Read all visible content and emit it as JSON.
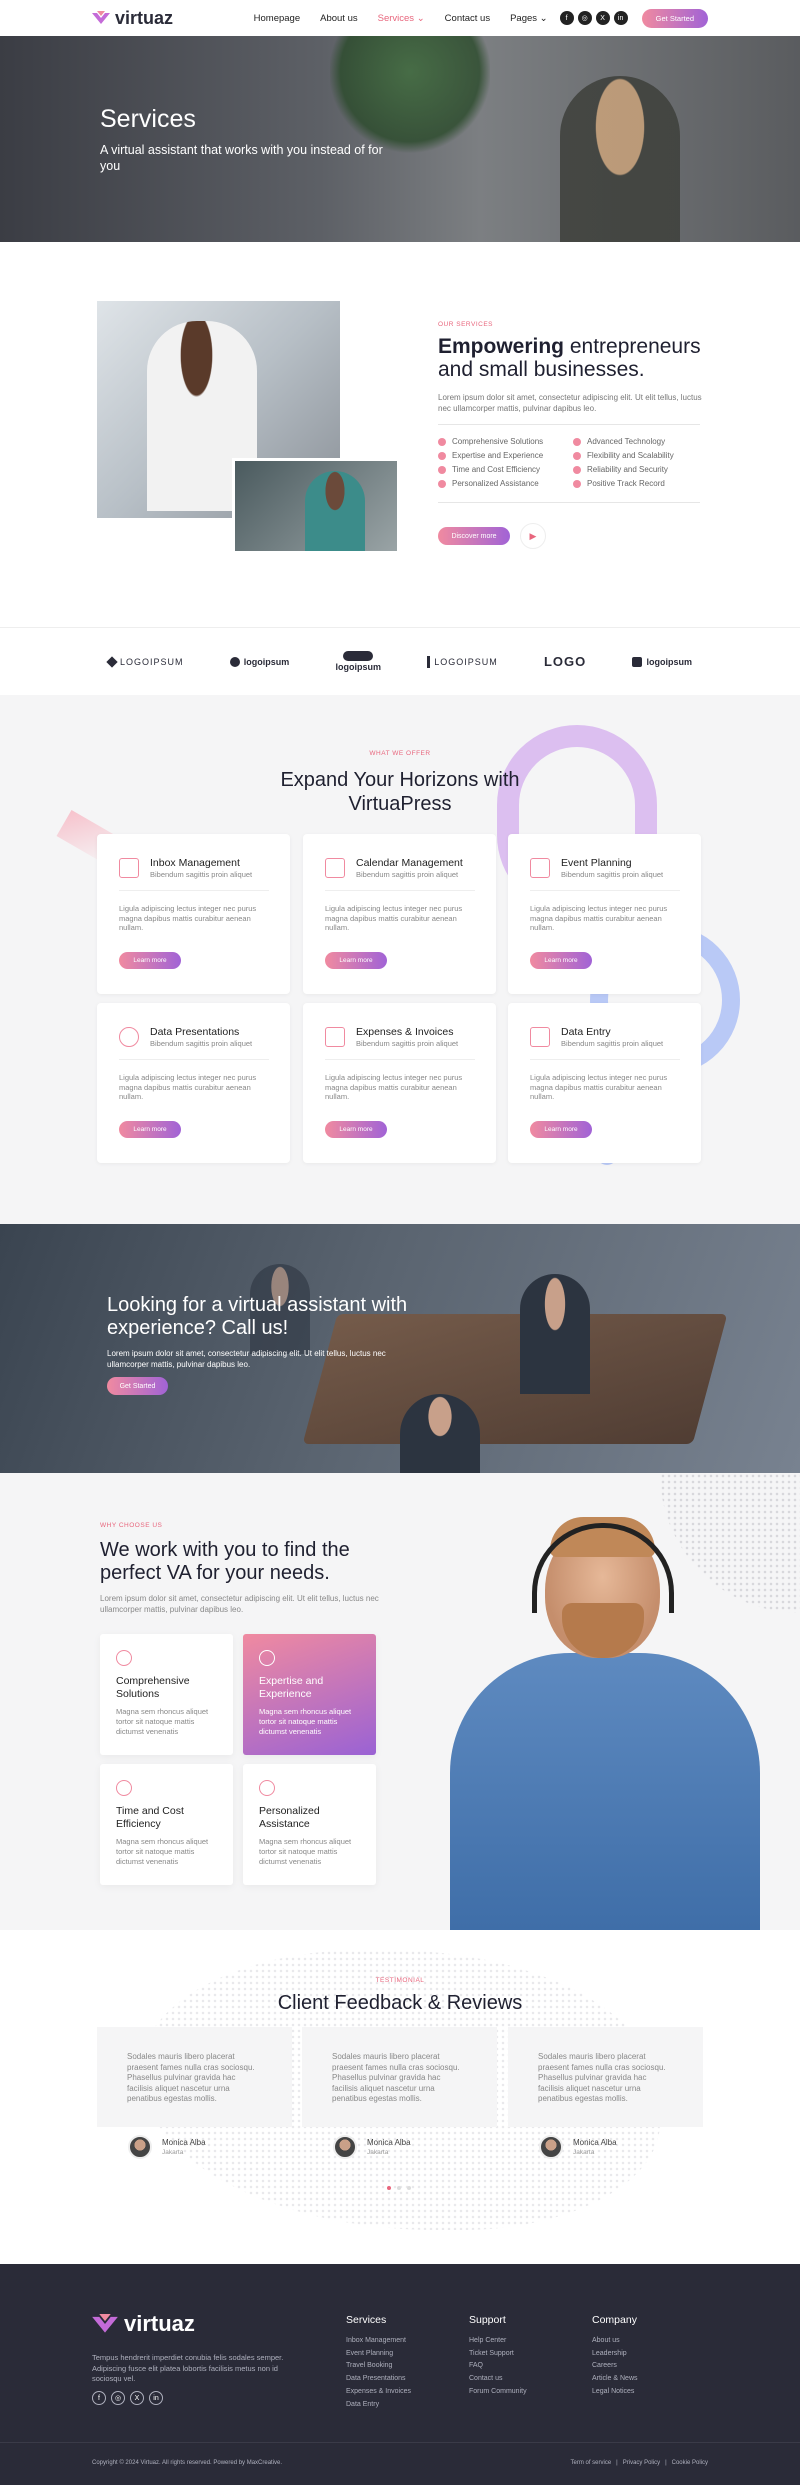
{
  "brand": {
    "name": "virtuaz",
    "accent": "#e8667d",
    "gradient_start": "#f08aa0",
    "gradient_end": "#a163d6"
  },
  "nav": {
    "links": [
      "Homepage",
      "About us",
      "Services",
      "Contact us",
      "Pages"
    ],
    "active": "Services",
    "social": [
      "f",
      "◎",
      "X",
      "in"
    ],
    "cta": "Get Started"
  },
  "hero": {
    "title": "Services",
    "subtitle": "A virtual assistant that works with you instead of for you"
  },
  "about": {
    "eyebrow": "OUR SERVICES",
    "title_bold": "Empowering",
    "title_rest": " entrepreneurs and small businesses.",
    "desc": "Lorem ipsum dolor sit amet, consectetur adipiscing elit. Ut elit tellus, luctus nec ullamcorper mattis, pulvinar dapibus leo.",
    "features_left": [
      "Comprehensive Solutions",
      "Expertise and Experience",
      "Time and Cost Efficiency",
      "Personalized Assistance"
    ],
    "features_right": [
      "Advanced Technology",
      "Flexibility and Scalability",
      "Reliability and Security",
      "Positive Track Record"
    ],
    "button": "Discover more",
    "play_icon": "▶"
  },
  "logos": [
    "LOGOIPSUM",
    "logoipsum",
    "logoipsum",
    "LOGOIPSUM",
    "LOGO",
    "logoipsum"
  ],
  "services": {
    "eyebrow": "WHAT WE OFFER",
    "title": "Expand Your Horizons with VirtuaPress",
    "cards": [
      {
        "title": "Inbox Management",
        "sub": "Bibendum sagittis proin aliquet",
        "desc": "Ligula adipiscing lectus integer nec purus magna dapibus mattis curabitur aenean nullam.",
        "button": "Learn more"
      },
      {
        "title": "Calendar Management",
        "sub": "Bibendum sagittis proin aliquet",
        "desc": "Ligula adipiscing lectus integer nec purus magna dapibus mattis curabitur aenean nullam.",
        "button": "Learn more"
      },
      {
        "title": "Event Planning",
        "sub": "Bibendum sagittis proin aliquet",
        "desc": "Ligula adipiscing lectus integer nec purus magna dapibus mattis curabitur aenean nullam.",
        "button": "Learn more"
      },
      {
        "title": "Data Presentations",
        "sub": "Bibendum sagittis proin aliquet",
        "desc": "Ligula adipiscing lectus integer nec purus magna dapibus mattis curabitur aenean nullam.",
        "button": "Learn more"
      },
      {
        "title": "Expenses & Invoices",
        "sub": "Bibendum sagittis proin aliquet",
        "desc": "Ligula adipiscing lectus integer nec purus magna dapibus mattis curabitur aenean nullam.",
        "button": "Learn more"
      },
      {
        "title": "Data Entry",
        "sub": "Bibendum sagittis proin aliquet",
        "desc": "Ligula adipiscing lectus integer nec purus magna dapibus mattis curabitur aenean nullam.",
        "button": "Learn more"
      }
    ]
  },
  "cta": {
    "title": "Looking for a virtual assistant with experience? Call us!",
    "desc": "Lorem ipsum dolor sit amet, consectetur adipiscing elit. Ut elit tellus, luctus nec ullamcorper mattis, pulvinar dapibus leo.",
    "button": "Get Started"
  },
  "why": {
    "eyebrow": "WHY CHOOSE US",
    "title": "We work with you to find the perfect VA for your needs.",
    "desc": "Lorem ipsum dolor sit amet, consectetur adipiscing elit. Ut elit tellus, luctus nec ullamcorper mattis, pulvinar dapibus leo.",
    "cards": [
      {
        "title": "Comprehensive Solutions",
        "desc": "Magna sem rhoncus aliquet tortor sit natoque mattis dictumst venenatis"
      },
      {
        "title": "Expertise and Experience",
        "desc": "Magna sem rhoncus aliquet tortor sit natoque mattis dictumst venenatis"
      },
      {
        "title": "Time and Cost Efficiency",
        "desc": "Magna sem rhoncus aliquet tortor sit natoque mattis dictumst venenatis"
      },
      {
        "title": "Personalized Assistance",
        "desc": "Magna sem rhoncus aliquet tortor sit natoque mattis dictumst venenatis"
      }
    ]
  },
  "testimonials": {
    "eyebrow": "TESTIMONIAL",
    "title": "Client Feedback & Reviews",
    "items": [
      {
        "text": "Sodales mauris libero placerat praesent fames nulla cras sociosqu. Phasellus pulvinar gravida hac facilisis aliquet nascetur urna penatibus egestas mollis.",
        "name": "Monica Alba",
        "city": "Jakarta"
      },
      {
        "text": "Sodales mauris libero placerat praesent fames nulla cras sociosqu. Phasellus pulvinar gravida hac facilisis aliquet nascetur urna penatibus egestas mollis.",
        "name": "Monica Alba",
        "city": "Jakarta"
      },
      {
        "text": "Sodales mauris libero placerat praesent fames nulla cras sociosqu. Phasellus pulvinar gravida hac facilisis aliquet nascetur urna penatibus egestas mollis.",
        "name": "Monica Alba",
        "city": "Jakarta"
      }
    ]
  },
  "footer": {
    "tagline": "Tempus hendrerit imperdiet conubia felis sodales semper. Adipiscing fusce elit platea lobortis facilisis metus non id sociosqu vel.",
    "columns": [
      {
        "title": "Services",
        "links": [
          "Inbox Management",
          "Event Planning",
          "Travel Booking",
          "Data Presentations",
          "Expenses & Invoices",
          "Data Entry"
        ]
      },
      {
        "title": "Support",
        "links": [
          "Help Center",
          "Ticket Support",
          "FAQ",
          "Contact us",
          "Forum Community"
        ]
      },
      {
        "title": "Company",
        "links": [
          "About us",
          "Leadership",
          "Careers",
          "Article & News",
          "Legal Notices"
        ]
      }
    ],
    "copyright": "Copyright © 2024 Virtuaz. All rights reserved. Powered by MaxCreative.",
    "legal": [
      "Term of service",
      "|",
      "Privacy Policy",
      "|",
      "Cookie Policy"
    ]
  }
}
